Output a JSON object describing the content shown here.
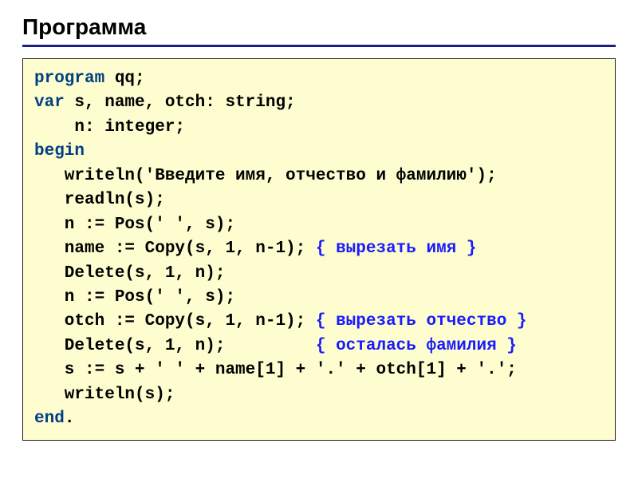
{
  "title": "Программа",
  "code": {
    "l1_kw": "program",
    "l1_rest": " qq;",
    "l2_kw": "var",
    "l2_rest": " s, name, otch: string;",
    "l3": "    n: integer;",
    "l4_kw": "begin",
    "l5": "   writeln('Введите имя, отчество и фамилию');",
    "l6": "   readln(s);",
    "l7": "   n := Pos(' ', s);",
    "l8_a": "   name := Copy(s, 1, n-1); ",
    "l8_cm": "{ вырезать имя }",
    "l9": "   Delete(s, 1, n);",
    "l10": "   n := Pos(' ', s);",
    "l11_a": "   otch := Copy(s, 1, n-1); ",
    "l11_cm": "{ вырезать отчество }",
    "l12_a": "   Delete(s, 1, n);         ",
    "l12_cm": "{ осталась фамилия }",
    "l13": "   s := s + ' ' + name[1] + '.' + otch[1] + '.';",
    "l14": "   writeln(s);",
    "l15_kw": "end",
    "l15_rest": "."
  }
}
